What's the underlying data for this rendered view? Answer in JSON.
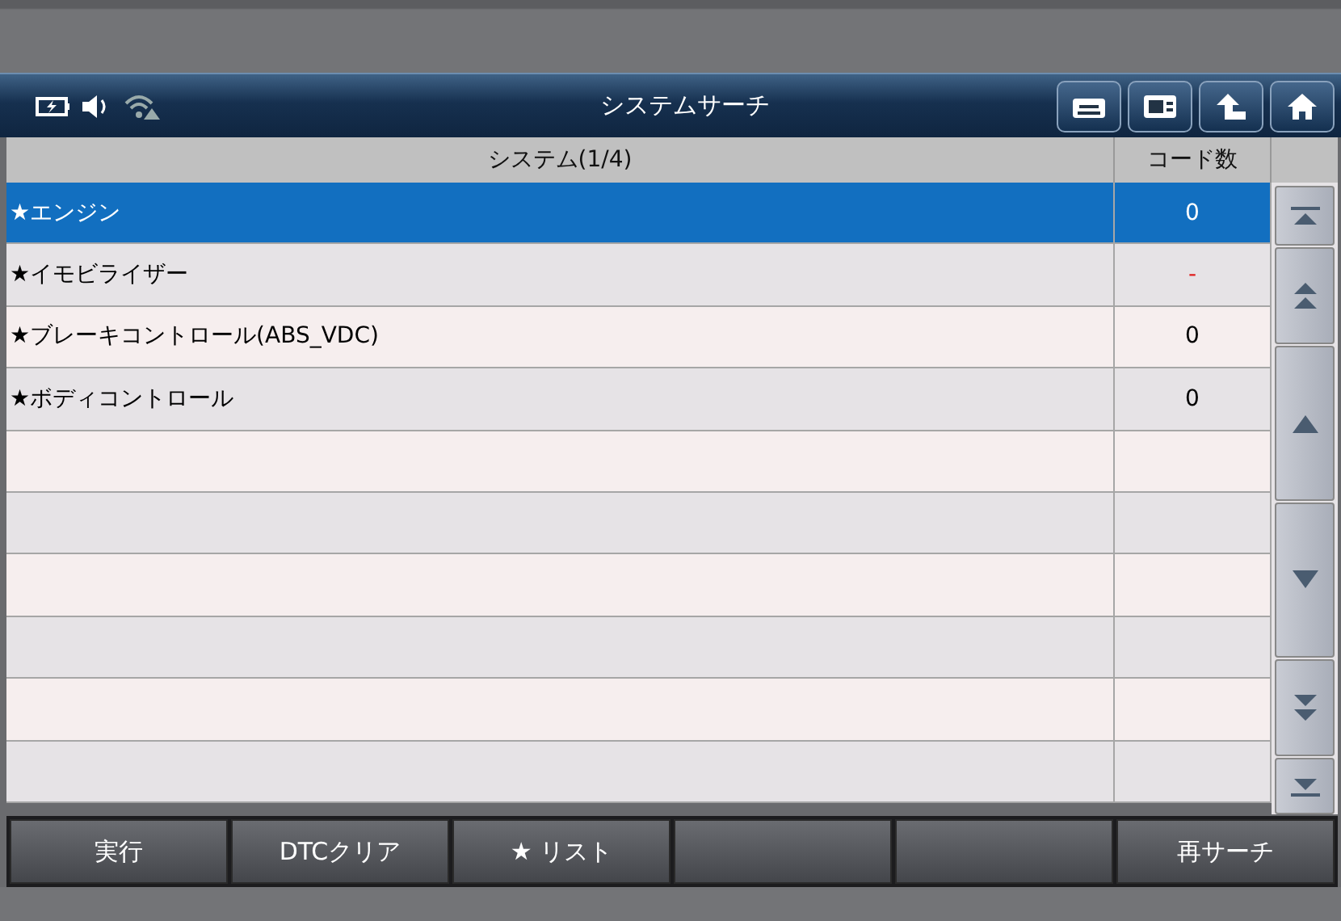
{
  "header": {
    "title": "システムサーチ"
  },
  "table": {
    "columns": [
      "システム(1/4)",
      "コード数"
    ],
    "rows": [
      {
        "name": "★エンジン",
        "code": "0",
        "selected": true,
        "color": "#ffffff"
      },
      {
        "name": "★イモビライザー",
        "code": "-",
        "selected": false,
        "color": "#e02020"
      },
      {
        "name": "★ブレーキコントロール(ABS_VDC)",
        "code": "0",
        "selected": false,
        "color": "#000000"
      },
      {
        "name": "★ボディコントロール",
        "code": "0",
        "selected": false,
        "color": "#000000"
      }
    ]
  },
  "footer_buttons": [
    {
      "kind": "label",
      "label": "実行"
    },
    {
      "kind": "label",
      "label": "DTCクリア"
    },
    {
      "kind": "label",
      "label": "★ リスト"
    },
    {
      "kind": "blank"
    },
    {
      "kind": "blank"
    },
    {
      "kind": "label",
      "label": "再サーチ"
    }
  ]
}
